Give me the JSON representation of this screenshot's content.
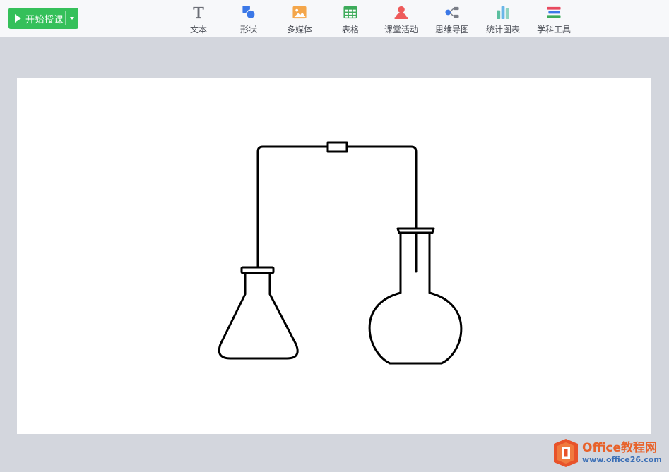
{
  "toolbar": {
    "start_label": "开始授课",
    "tools": [
      {
        "label": "文本",
        "icon": "text-icon"
      },
      {
        "label": "形状",
        "icon": "shape-icon"
      },
      {
        "label": "多媒体",
        "icon": "media-icon"
      },
      {
        "label": "表格",
        "icon": "table-icon"
      },
      {
        "label": "课堂活动",
        "icon": "class-activity-icon"
      },
      {
        "label": "思维导图",
        "icon": "mindmap-icon"
      },
      {
        "label": "统计图表",
        "icon": "chart-icon"
      },
      {
        "label": "学科工具",
        "icon": "subject-tools-icon"
      }
    ]
  },
  "colors": {
    "accent_green": "#35c05a",
    "background": "#d3d6dd",
    "canvas": "#ffffff",
    "stroke": "#000000"
  },
  "canvas": {
    "content": "chemistry apparatus: conical flask connected by glass tube to round-bottom flask"
  },
  "watermark": {
    "title": "Office教程网",
    "url": "www.office26.com"
  }
}
